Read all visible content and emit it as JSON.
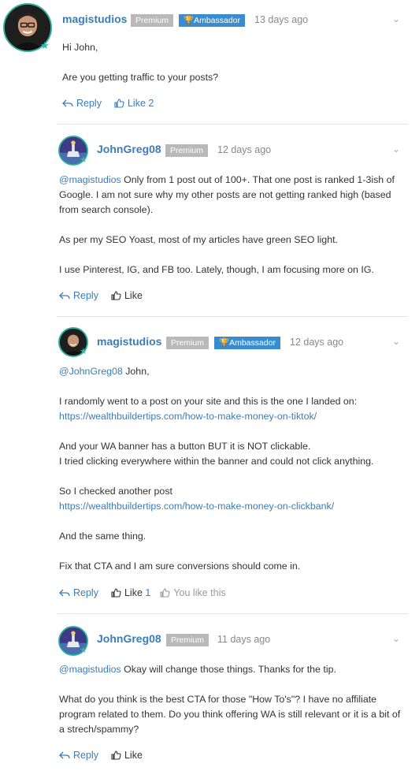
{
  "comments": [
    {
      "username": "magistudios",
      "badges": [
        "Premium",
        "Ambassador"
      ],
      "timestamp": "13 days ago",
      "paragraphs": [
        "Hi John,",
        "Are you getting traffic to your posts?"
      ],
      "reply_label": "Reply",
      "like_label": "Like 2"
    },
    {
      "username": "JohnGreg08",
      "badges": [
        "Premium"
      ],
      "timestamp": "12 days ago",
      "mention": "@magistudios",
      "p1_rest": " Only from 1 post out of 100+. That one post is ranked 1-3ish of Google. I am not sure why my other posts are not getting ranked high (based from search console).",
      "p2": "As per my SEO Yoast, most of my articles have green SEO light.",
      "p3": "I use Pinterest, IG, and FB too. Lately, though, I am focusing more on IG.",
      "reply_label": "Reply",
      "like_label": "Like"
    },
    {
      "username": "magistudios",
      "badges": [
        "Premium",
        "Ambassador"
      ],
      "timestamp": "12 days ago",
      "mention": "@JohnGreg08",
      "mention_rest": " John,",
      "p2": "I randomly went to a post on your site and this is the one I landed on:",
      "link1": "https://wealthbuildertips.com/how-to-make-money-on-tiktok/",
      "p3a": "And your WA banner has a button BUT it is NOT clickable.",
      "p3b": "I tried clicking everywhere within the banner and could not click anything.",
      "p4": "So I checked another post",
      "link2": "https://wealthbuildertips.com/how-to-make-money-on-clickbank/",
      "p5": "And the same thing.",
      "p6": "Fix that CTA and I am sure conversions should come in.",
      "reply_label": "Reply",
      "like_label": "Like",
      "like_count": "1",
      "you_like_label": "You like this"
    },
    {
      "username": "JohnGreg08",
      "badges": [
        "Premium"
      ],
      "timestamp": "11 days ago",
      "mention": "@magistudios",
      "p1_rest": " Okay will change those things. Thanks for the tip.",
      "p2": "What do you think is the best CTA for those \"How To's\"? I have no affiliate program related to them. Do you think offering WA is still relevant or it is a bit of a strech/spammy?",
      "reply_label": "Reply",
      "like_label": "Like"
    }
  ],
  "icons": {
    "star": "star-icon",
    "trophy": "trophy-icon",
    "reply": "reply-icon",
    "like": "thumbs-up-icon",
    "menu": "chevron-down-icon"
  },
  "colors": {
    "link": "#3b7cb8",
    "premium_badge": "#b9b9b9",
    "ambassador_badge": "#3a8cd0",
    "avatar_ring": "#2fb0a0"
  }
}
